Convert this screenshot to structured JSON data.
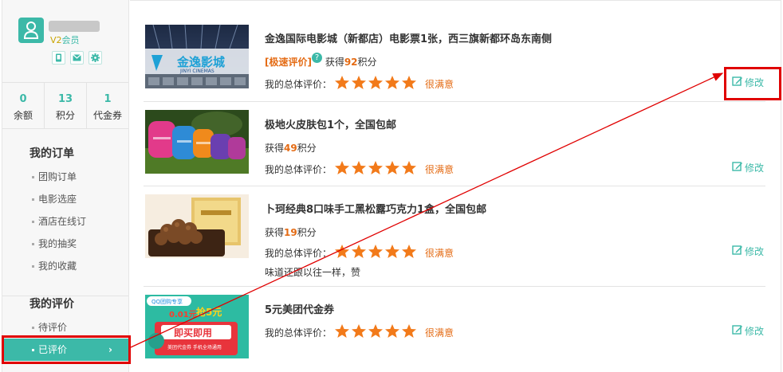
{
  "user": {
    "level": "V2会员"
  },
  "stats": [
    {
      "num": "0",
      "label": "余额"
    },
    {
      "num": "13",
      "label": "积分"
    },
    {
      "num": "1",
      "label": "代金券"
    }
  ],
  "orders": {
    "title": "我的订单",
    "items": [
      "团购订单",
      "电影选座",
      "酒店在线订",
      "我的抽奖",
      "我的收藏"
    ]
  },
  "reviews": {
    "title": "我的评价",
    "items": [
      "待评价",
      "已评价"
    ]
  },
  "labels": {
    "rating_label": "我的总体评价：",
    "satisfaction": "很满意",
    "edit": "修改",
    "earn_prefix": "获得",
    "earn_suffix": "积分",
    "fast_review": "[极速评价]"
  },
  "list": [
    {
      "title": "金逸国际电影城（新都店）电影票1张，西三旗新都环岛东南侧",
      "points": "92",
      "stars": 5,
      "fast": true,
      "comment": ""
    },
    {
      "title": "极地火皮肤包1个，全国包邮",
      "points": "49",
      "stars": 5,
      "fast": false,
      "comment": ""
    },
    {
      "title": "卜珂经典8口味手工黑松露巧克力1盒，全国包邮",
      "points": "19",
      "stars": 5,
      "fast": false,
      "comment": "味道还跟以往一样，赞"
    },
    {
      "title": "5元美团代金券",
      "points": "",
      "stars": 5,
      "fast": false,
      "comment": ""
    }
  ],
  "thumbs": {
    "cinema_text": "金逸影城",
    "cinema_sub": "JINYI CINEMAS",
    "coupon_badge": "QQ团购专享",
    "coupon_price": "0.01元",
    "coupon_grab": "抢5元",
    "coupon_btn": "即买即用",
    "coupon_line": "美团代金券 手机全场通用"
  },
  "colors": {
    "accent": "#3cb9a8",
    "orange": "#e46b14",
    "annotation": "#e00000"
  }
}
